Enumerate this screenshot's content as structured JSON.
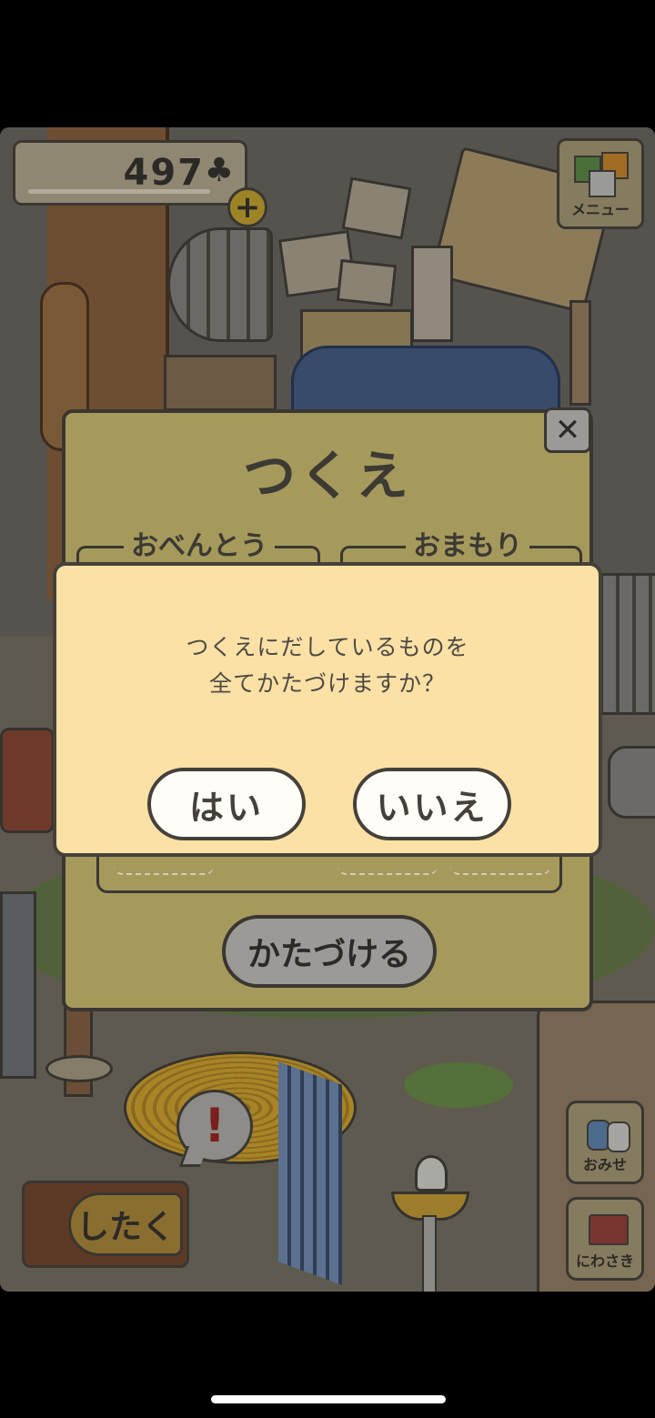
{
  "hud": {
    "coin_count": "497",
    "coin_symbol": "♣",
    "plus_label": "+",
    "menu_label": "メニュー",
    "shop_label": "おみせ",
    "yard_label": "にわさき",
    "prepare_label": "したく",
    "alert_label": "!"
  },
  "desk": {
    "title": "つくえ",
    "close_label": "✕",
    "slot_left_label": "おべんとう",
    "slot_right_label": "おまもり",
    "cleanup_label": "かたづける"
  },
  "confirm": {
    "line1": "つくえにだしているものを",
    "line2": "全てかたづけますか？",
    "yes_label": "はい",
    "no_label": "いいえ"
  }
}
